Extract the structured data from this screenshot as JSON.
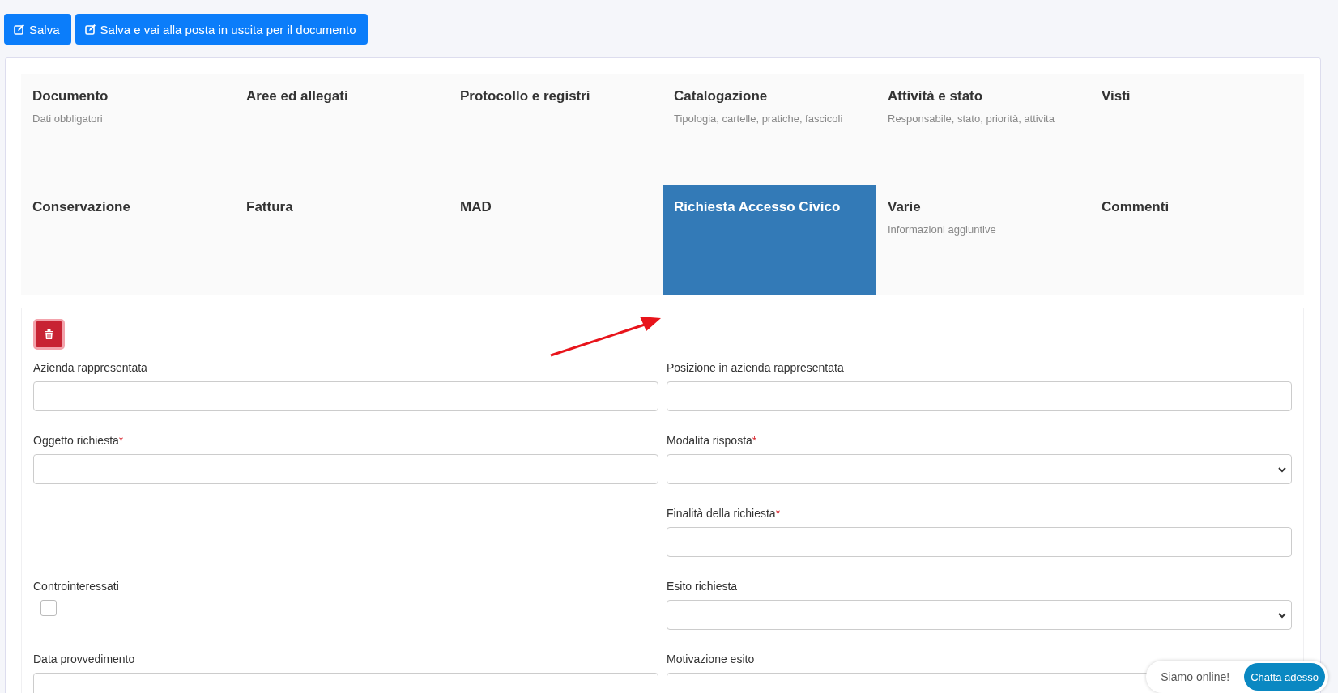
{
  "toolbar": {
    "buttons": [
      "Salva",
      "Salva e vai alla posta in uscita per il documento"
    ]
  },
  "tabs": [
    {
      "label": "Documento",
      "subtitle": "Dati obbligatori",
      "selected": false
    },
    {
      "label": "Aree ed allegati",
      "selected": false
    },
    {
      "label": "Protocollo e registri",
      "selected": false
    },
    {
      "label": "Catalogazione",
      "subtitle": "Tipologia, cartelle, pratiche, fascicoli",
      "selected": false
    },
    {
      "label": "Attività e stato",
      "subtitle": "Responsabile, stato, priorità, attivita",
      "selected": false
    },
    {
      "label": "Visti",
      "selected": false
    },
    {
      "label": "Conservazione",
      "selected": false
    },
    {
      "label": "Fattura",
      "selected": false
    },
    {
      "label": "MAD",
      "selected": false
    },
    {
      "label": "Richiesta Accesso Civico",
      "selected": true
    },
    {
      "label": "Varie",
      "subtitle": "Informazioni aggiuntive",
      "selected": false
    },
    {
      "label": "Commenti",
      "selected": false
    }
  ],
  "form": {
    "rows": [
      {
        "left": {
          "label": "Azienda rappresentata",
          "kind": "text"
        },
        "right": {
          "label": "Posizione in azienda rappresentata",
          "kind": "text"
        }
      },
      {
        "left": {
          "label": "Oggetto richiesta",
          "kind": "text",
          "required_mark": "*"
        },
        "right": {
          "label": "Modalita risposta",
          "kind": "select",
          "required_mark": "*"
        }
      },
      {
        "right": {
          "label": "Finalità della richiesta",
          "kind": "text",
          "required_mark": "*"
        }
      },
      {
        "left": {
          "label": "Controinteressati",
          "kind": "checkbox",
          "checked": false
        },
        "right": {
          "label": "Esito richiesta",
          "kind": "select"
        }
      },
      {
        "left": {
          "label": "Data provvedimento",
          "kind": "text"
        },
        "right": {
          "label": "Motivazione esito",
          "kind": "textarea"
        }
      }
    ]
  },
  "chat": {
    "status": "Siamo online!",
    "button": "Chatta adesso"
  }
}
